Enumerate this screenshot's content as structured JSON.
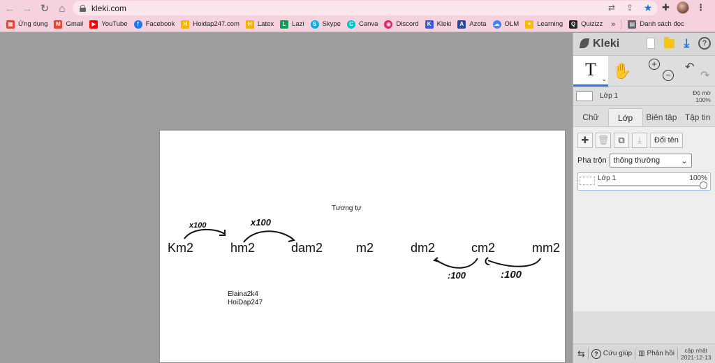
{
  "browser": {
    "url": "kleki.com",
    "bookmarks": [
      {
        "label": "Ứng dụng",
        "icon": "apps-grid-icon",
        "color": "#ea4335"
      },
      {
        "label": "Gmail",
        "icon": "gmail-icon",
        "color": "#ea4335"
      },
      {
        "label": "YouTube",
        "icon": "youtube-icon",
        "color": "#ff0000"
      },
      {
        "label": "Facebook",
        "icon": "facebook-icon",
        "color": "#1877f2"
      },
      {
        "label": "Hoidap247.com",
        "icon": "hoidap-icon",
        "color": "#f4b400"
      },
      {
        "label": "Latex",
        "icon": "latex-icon",
        "color": "#f4b400"
      },
      {
        "label": "Lazi",
        "icon": "lazi-icon",
        "color": "#0f9d58"
      },
      {
        "label": "Skype",
        "icon": "skype-icon",
        "color": "#00aff0"
      },
      {
        "label": "Canva",
        "icon": "canva-icon",
        "color": "#00c4cc"
      },
      {
        "label": "Discord",
        "icon": "discord-icon",
        "color": "#e0245e"
      },
      {
        "label": "Kleki",
        "icon": "kleki-icon",
        "color": "#3b5bdb"
      },
      {
        "label": "Azota",
        "icon": "azota-icon",
        "color": "#2b4c9e"
      },
      {
        "label": "OLM",
        "icon": "olm-icon",
        "color": "#4285f4"
      },
      {
        "label": "Learning",
        "icon": "learning-icon",
        "color": "#fbbc05"
      },
      {
        "label": "Quizizz",
        "icon": "quizizz-icon",
        "color": "#222222"
      }
    ],
    "more": "»",
    "reading_list": "Danh sách đọc"
  },
  "canvas": {
    "units": [
      "Km2",
      "hm2",
      "dam2",
      "m2",
      "dm2",
      "cm2",
      "mm2"
    ],
    "caption": "Tương tự",
    "ink_multiply": "x100",
    "ink_divide": ":100",
    "signature_line1": "Elaina2k4",
    "signature_line2": "HoiDap247"
  },
  "panel": {
    "app_name": "Kleki",
    "active_tool": "T",
    "layer_name": "Lớp 1",
    "opacity_label": "Độ mờ",
    "opacity_value": "100%",
    "tabs": [
      "Chữ",
      "Lớp",
      "Biên tập",
      "Tập tin"
    ],
    "active_tab": "Lớp",
    "rename_label": "Đổi tên",
    "blend_label": "Pha trộn",
    "blend_value": "thông thường",
    "layer_card_name": "Lớp 1",
    "layer_card_opacity": "100%",
    "footer_help": "Cứu giúp",
    "footer_feedback": "Phản hồi",
    "footer_update_label": "cập nhật",
    "footer_update_date": "2021-12-13"
  }
}
